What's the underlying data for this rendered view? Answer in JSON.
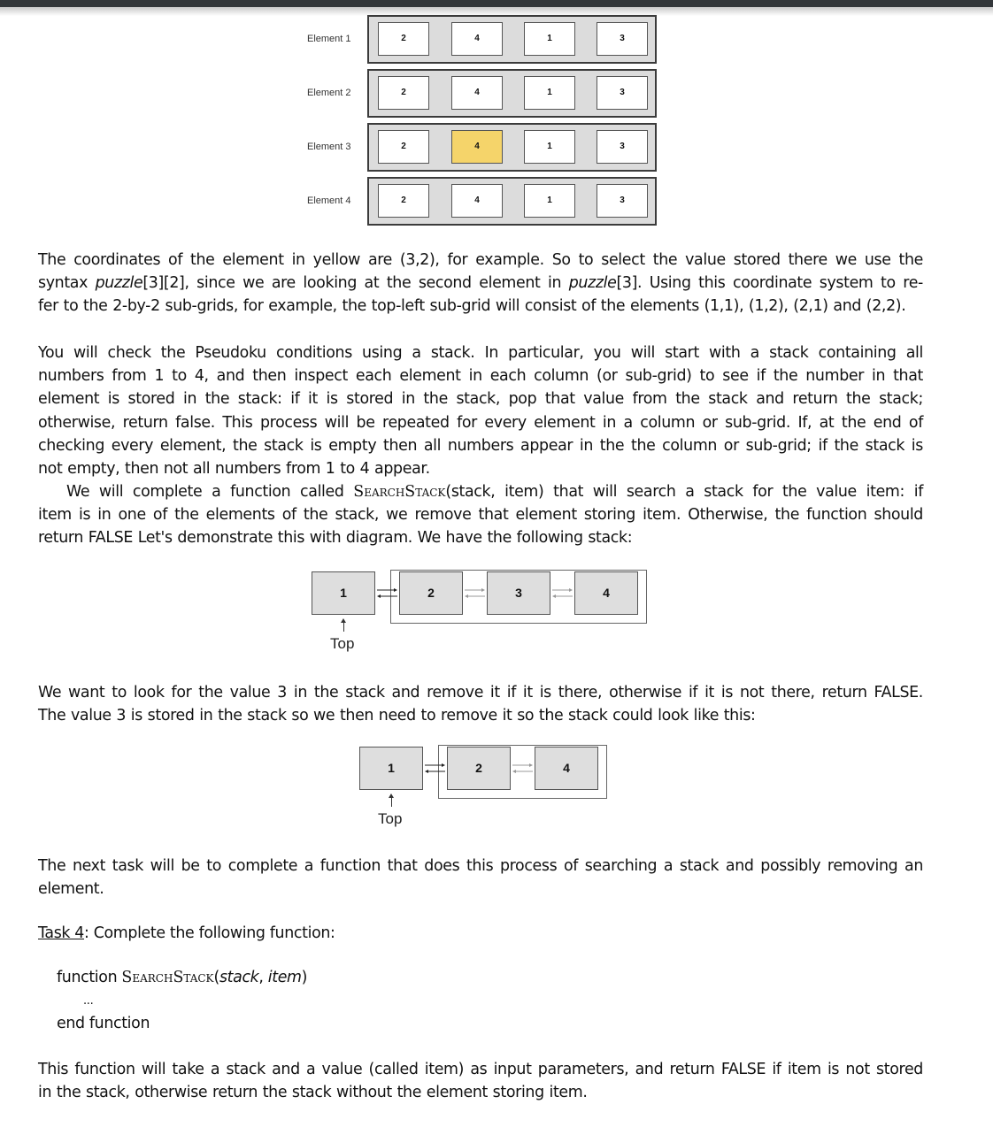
{
  "grid": {
    "rows": [
      {
        "label": "Element 1",
        "cells": [
          "2",
          "4",
          "1",
          "3"
        ],
        "highlight": null
      },
      {
        "label": "Element 2",
        "cells": [
          "2",
          "4",
          "1",
          "3"
        ],
        "highlight": null
      },
      {
        "label": "Element 3",
        "cells": [
          "2",
          "4",
          "1",
          "3"
        ],
        "highlight": 1
      },
      {
        "label": "Element 4",
        "cells": [
          "2",
          "4",
          "1",
          "3"
        ],
        "highlight": null
      }
    ],
    "highlight_color": "#f5d46a"
  },
  "para1": {
    "l1": "The coordinates of the element in yellow are (3,2), for example.  So to select the value stored there we use the",
    "l2a": "syntax ",
    "l2b": "puzzle",
    "l2c": "[3][2], since we are looking at the second element in ",
    "l2d": "puzzle",
    "l2e": "[3].  Using this coordinate system to re-",
    "l3": "fer to the 2-by-2 sub-grids, for example, the top-left sub-grid will consist of the elements (1,1), (1,2), (2,1) and (2,2)."
  },
  "para2": {
    "lines": [
      "You will check the Pseudoku conditions using a stack.  In particular, you will start with a stack containing all",
      "numbers from 1 to 4, and then inspect each element in each column (or sub-grid) to see if the number in that",
      "element is stored in the stack: if it is stored in the stack, pop that value from the stack and return the stack;",
      "otherwise, return false.  This process will be repeated for every element in a column or sub-grid.  If, at the end of",
      "checking every element, the stack is empty then all numbers appear in the the column or sub-grid; if the stack is",
      "not empty, then not all numbers from 1 to 4 appear."
    ]
  },
  "para3": {
    "l1a": "We will complete a function called ",
    "l1b": "SearchStack",
    "l1c": "(stack, item) that will search a stack for the value item: if",
    "l2": "item is in one of the elements of the stack, we remove that element storing item.  Otherwise, the function should",
    "l3": "return FALSE Let's demonstrate this with diagram.  We have the following stack:"
  },
  "stack1": {
    "nodes": [
      "1",
      "2",
      "3",
      "4"
    ],
    "top_label": "Top"
  },
  "para4": {
    "lines": [
      "We want to look for the value 3 in the stack and remove it if it is there, otherwise if it is not there, return FALSE.",
      "The value 3 is stored in the stack so we then need to remove it so the stack could look like this:"
    ]
  },
  "stack2": {
    "nodes": [
      "1",
      "2",
      "4"
    ],
    "top_label": "Top"
  },
  "para5": {
    "lines": [
      "The next task will be to complete a function that does this process of searching a stack and possibly removing an",
      "element."
    ]
  },
  "task": {
    "label": "Task 4",
    "text": ": Complete the following function:"
  },
  "code": {
    "kw_function": "function ",
    "name": "SearchStack",
    "open": "(",
    "arg1": "stack",
    "sep": ", ",
    "arg2": "item",
    "close": ")",
    "body": "...",
    "end": "end function"
  },
  "para6": {
    "lines": [
      "This function will take a stack and a value (called item) as input parameters, and return FALSE if item is not stored",
      "in the stack, otherwise return the stack without the element storing item."
    ]
  }
}
